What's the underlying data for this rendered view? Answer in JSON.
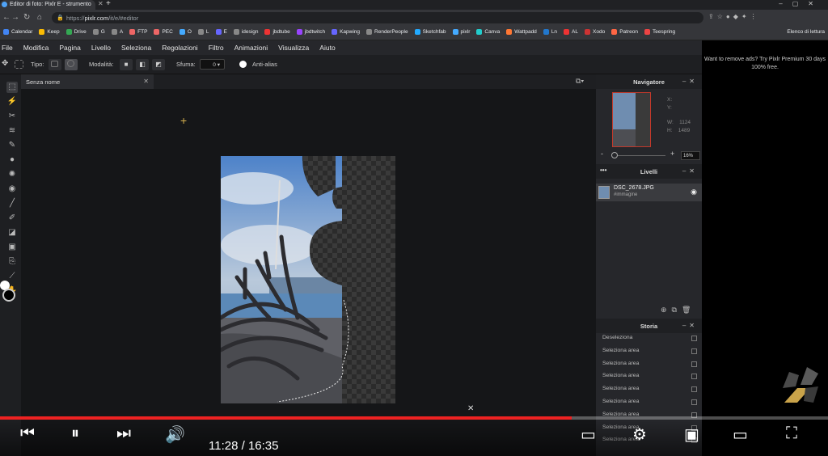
{
  "browser": {
    "tab_title": "Editor di foto: Pixlr E - strumento",
    "url_prefix": "https://",
    "url_host": "pixlr.com",
    "url_path": "/it/e/#editor",
    "bookmarks": [
      {
        "label": "Calendar",
        "color": "#4285f4"
      },
      {
        "label": "Keep",
        "color": "#fbbc04"
      },
      {
        "label": "Drive",
        "color": "#34a853"
      },
      {
        "label": "G",
        "color": "#888"
      },
      {
        "label": "A",
        "color": "#888"
      },
      {
        "label": "FTP",
        "color": "#e66"
      },
      {
        "label": "PEC",
        "color": "#e66"
      },
      {
        "label": "O",
        "color": "#4af"
      },
      {
        "label": "L",
        "color": "#888"
      },
      {
        "label": "E",
        "color": "#66f"
      },
      {
        "label": "idesign",
        "color": "#888"
      },
      {
        "label": "jbdtube",
        "color": "#e33"
      },
      {
        "label": "jbdtwitch",
        "color": "#94f"
      },
      {
        "label": "Kapwing",
        "color": "#66f"
      },
      {
        "label": "RenderPeople",
        "color": "#888"
      },
      {
        "label": "Sketchfab",
        "color": "#2af"
      },
      {
        "label": "pixlr",
        "color": "#4af"
      },
      {
        "label": "Canva",
        "color": "#2cc"
      },
      {
        "label": "Wattpadd",
        "color": "#f73"
      },
      {
        "label": "Ln",
        "color": "#27c"
      },
      {
        "label": "AL",
        "color": "#e33"
      },
      {
        "label": "Xodo",
        "color": "#c33"
      },
      {
        "label": "Patreon",
        "color": "#f64"
      },
      {
        "label": "Teespring",
        "color": "#e44"
      }
    ],
    "bookmarks_other": "Elenco di lettura"
  },
  "menu": [
    "File",
    "Modifica",
    "Pagina",
    "Livello",
    "Seleziona",
    "Regolazioni",
    "Filtro",
    "Animazioni",
    "Visualizza",
    "Aiuto"
  ],
  "options": {
    "type_label": "Tipo:",
    "mode_label": "Modalità:",
    "feather_label": "Sfuma:",
    "feather_value": "0",
    "antialias_label": "Anti-alias"
  },
  "document": {
    "tab_name": "Senza nome"
  },
  "navigator": {
    "title": "Navigatore",
    "x_label": "X:",
    "y_label": "Y:",
    "w_label": "W:",
    "w_value": "1124",
    "h_label": "H:",
    "h_value": "1489",
    "zoom": "16%"
  },
  "layers": {
    "title": "Livelli",
    "items": [
      {
        "name": "DSC_2678.JPG",
        "type": "#immagine"
      }
    ]
  },
  "history": {
    "title": "Storia",
    "items": [
      "Deseleziona",
      "Seleziona area",
      "Seleziona area",
      "Seleziona area",
      "Seleziona area",
      "Seleziona area",
      "Seleziona area",
      "Seleziona area",
      "Seleziona area"
    ]
  },
  "ad": {
    "text": "Want to remove ads? Try Pixlr Premium 30 days 100% free."
  },
  "video": {
    "current_time": "11:28",
    "duration": "16:35",
    "time_separator": " / ",
    "progress": 0.69,
    "accent": "#ee2222"
  }
}
